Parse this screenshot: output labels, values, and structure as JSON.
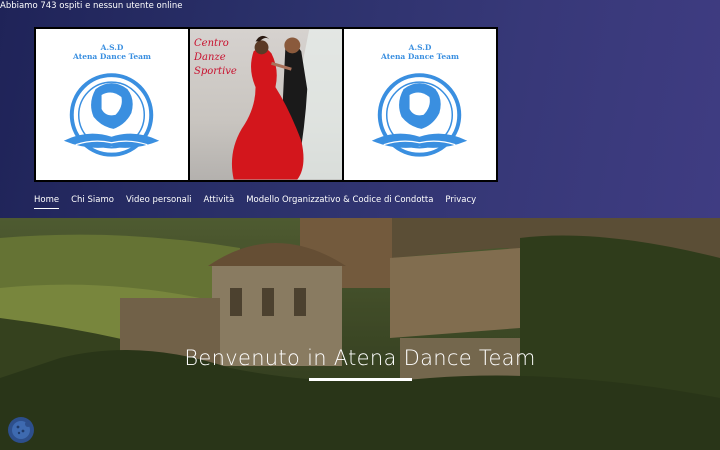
{
  "header": {
    "online_status": "Abbiamo 743 ospiti e nessun utente online"
  },
  "banner": {
    "left_logo": {
      "line1": "A.S.D",
      "line2": "Atena Dance Team"
    },
    "center_image": {
      "line1": "Centro",
      "line2": "Danze",
      "line3": "Sportive"
    },
    "right_logo": {
      "line1": "A.S.D",
      "line2": "Atena Dance Team"
    }
  },
  "nav": {
    "items": [
      {
        "label": "Home",
        "active": true
      },
      {
        "label": "Chi Siamo"
      },
      {
        "label": "Video personali"
      },
      {
        "label": "Attività"
      },
      {
        "label": "Modello Organizzativo & Codice di Condotta"
      },
      {
        "label": "Privacy"
      }
    ]
  },
  "hero": {
    "title": "Benvenuto in Atena Dance Team"
  },
  "cookie": {
    "icon": "cookie-icon"
  },
  "colors": {
    "accent_blue": "#3a8fe0",
    "header_bg": "#2f3270",
    "cds_red": "#c8102e"
  }
}
